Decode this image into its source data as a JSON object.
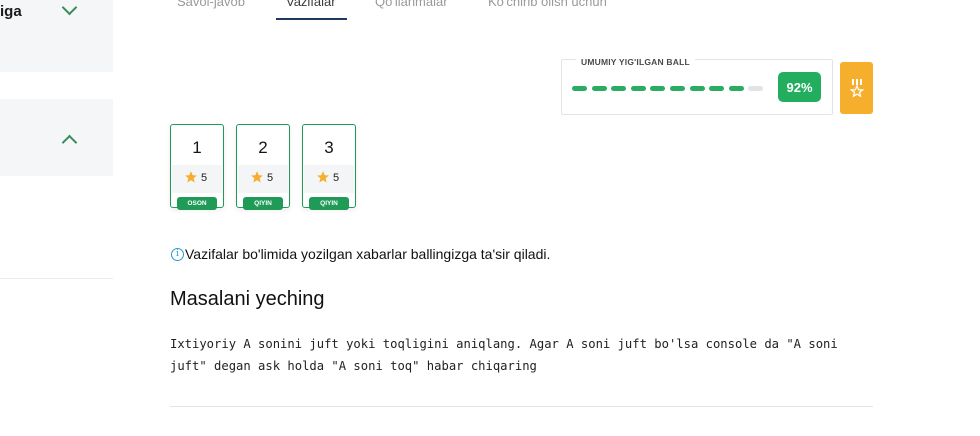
{
  "sidebar": {
    "section1_label": "iga",
    "icons": {
      "expand": "chevron-down-icon",
      "collapse": "chevron-up-icon"
    }
  },
  "tabs": [
    {
      "label": "Savol-javob",
      "active": false
    },
    {
      "label": "Vazifalar",
      "active": true
    },
    {
      "label": "Qo'llanmalar",
      "active": false
    },
    {
      "label": "Ko'chirib olish uchun",
      "active": false
    }
  ],
  "score": {
    "label": "UMUMIY YIG'ILGAN BALL",
    "percent_text": "92%",
    "progress": 0.92,
    "total_segments": 10,
    "filled_segments": 9
  },
  "tasks": [
    {
      "number": "1",
      "score": "5",
      "difficulty": "OSON"
    },
    {
      "number": "2",
      "score": "5",
      "difficulty": "QIYIN"
    },
    {
      "number": "3",
      "score": "5",
      "difficulty": "QIYIN"
    }
  ],
  "info": {
    "icon": "info-icon",
    "text": "Vazifalar bo'limida yozilgan xabarlar ballingizga ta'sir qiladi."
  },
  "problem": {
    "title": "Masalani yeching",
    "line1": "Ixtiyoriy A sonini juft yoki toqligini aniqlang. Agar A soni juft bo'lsa console da \"A soni",
    "line2": "juft\" degan ask holda \"A soni toq\" habar chiqaring"
  },
  "colors": {
    "accent_green": "#22ad5f",
    "medal_orange": "#f6ae2d",
    "tab_underline": "#1f3a5f",
    "info_blue": "#2a9ad6"
  }
}
